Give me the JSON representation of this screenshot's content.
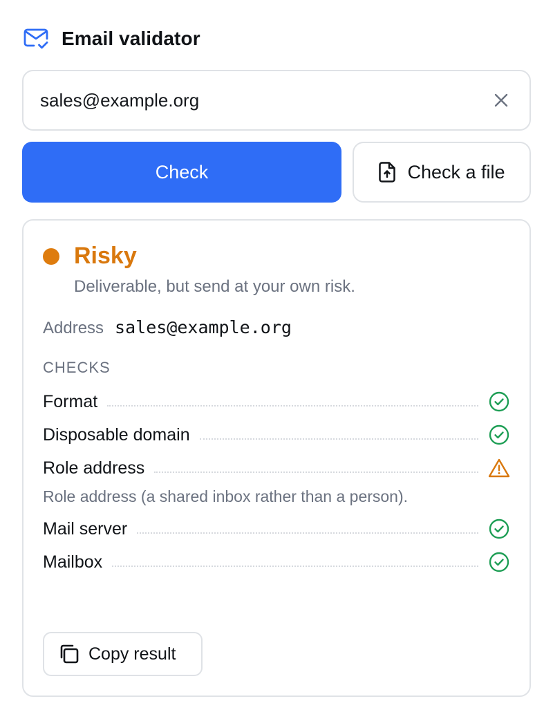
{
  "app": {
    "title": "Email validator",
    "icon": "mail-check-icon"
  },
  "input": {
    "value": "sales@example.org",
    "clear_icon": "close-icon"
  },
  "actions": {
    "check_label": "Check",
    "check_file_label": "Check a file",
    "file_icon": "file-upload-icon"
  },
  "result": {
    "status": "Risky",
    "status_color": "#d9780d",
    "description": "Deliverable, but send at your own risk.",
    "address_label": "Address",
    "address_value": "sales@example.org",
    "checks_heading": "CHECKS",
    "checks": [
      {
        "name": "Format",
        "state": "pass",
        "icon": "check-circle-icon"
      },
      {
        "name": "Disposable domain",
        "state": "pass",
        "icon": "check-circle-icon"
      },
      {
        "name": "Role address",
        "state": "warning",
        "icon": "warning-triangle-icon",
        "note": "Role address (a shared inbox rather than a person)."
      },
      {
        "name": "Mail server",
        "state": "pass",
        "icon": "check-circle-icon"
      },
      {
        "name": "Mailbox",
        "state": "pass",
        "icon": "check-circle-icon"
      }
    ],
    "copy_label": "Copy result",
    "copy_icon": "copy-icon"
  },
  "colors": {
    "primary": "#2f6df6",
    "pass": "#1e9e55",
    "warning": "#d9780d"
  }
}
